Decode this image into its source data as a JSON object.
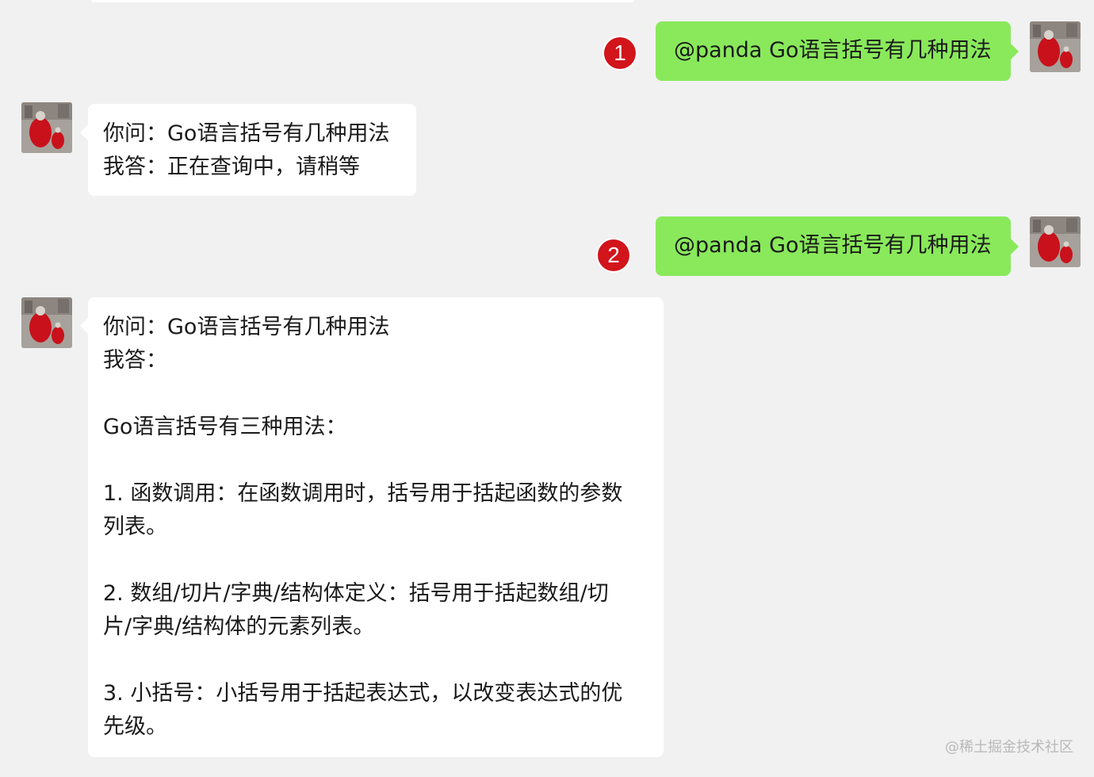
{
  "chat": {
    "messages": [
      {
        "side": "sent",
        "badge": "1",
        "text": "@panda Go语言括号有几种用法"
      },
      {
        "side": "received",
        "lines": [
          "你问：Go语言括号有几种用法",
          "我答：正在查询中，请稍等"
        ]
      },
      {
        "side": "sent",
        "badge": "2",
        "text": "@panda Go语言括号有几种用法"
      },
      {
        "side": "received",
        "lines": [
          "你问：Go语言括号有几种用法",
          "我答：",
          "",
          "Go语言括号有三种用法：",
          "",
          "1. 函数调用：在函数调用时，括号用于括起函数的参数",
          "列表。",
          "",
          "2. 数组/切片/字典/结构体定义：括号用于括起数组/切",
          "片/字典/结构体的元素列表。",
          "",
          "3. 小括号：小括号用于括起表达式，以改变表达式的优",
          "先级。"
        ]
      }
    ]
  },
  "watermark": "@稀土掘金技术社区",
  "colors": {
    "background": "#f1f1f1",
    "sent_bubble": "#89e95b",
    "received_bubble": "#ffffff",
    "badge": "#d2141b"
  },
  "icons": {
    "avatar": "red-figure-statue-photo"
  }
}
